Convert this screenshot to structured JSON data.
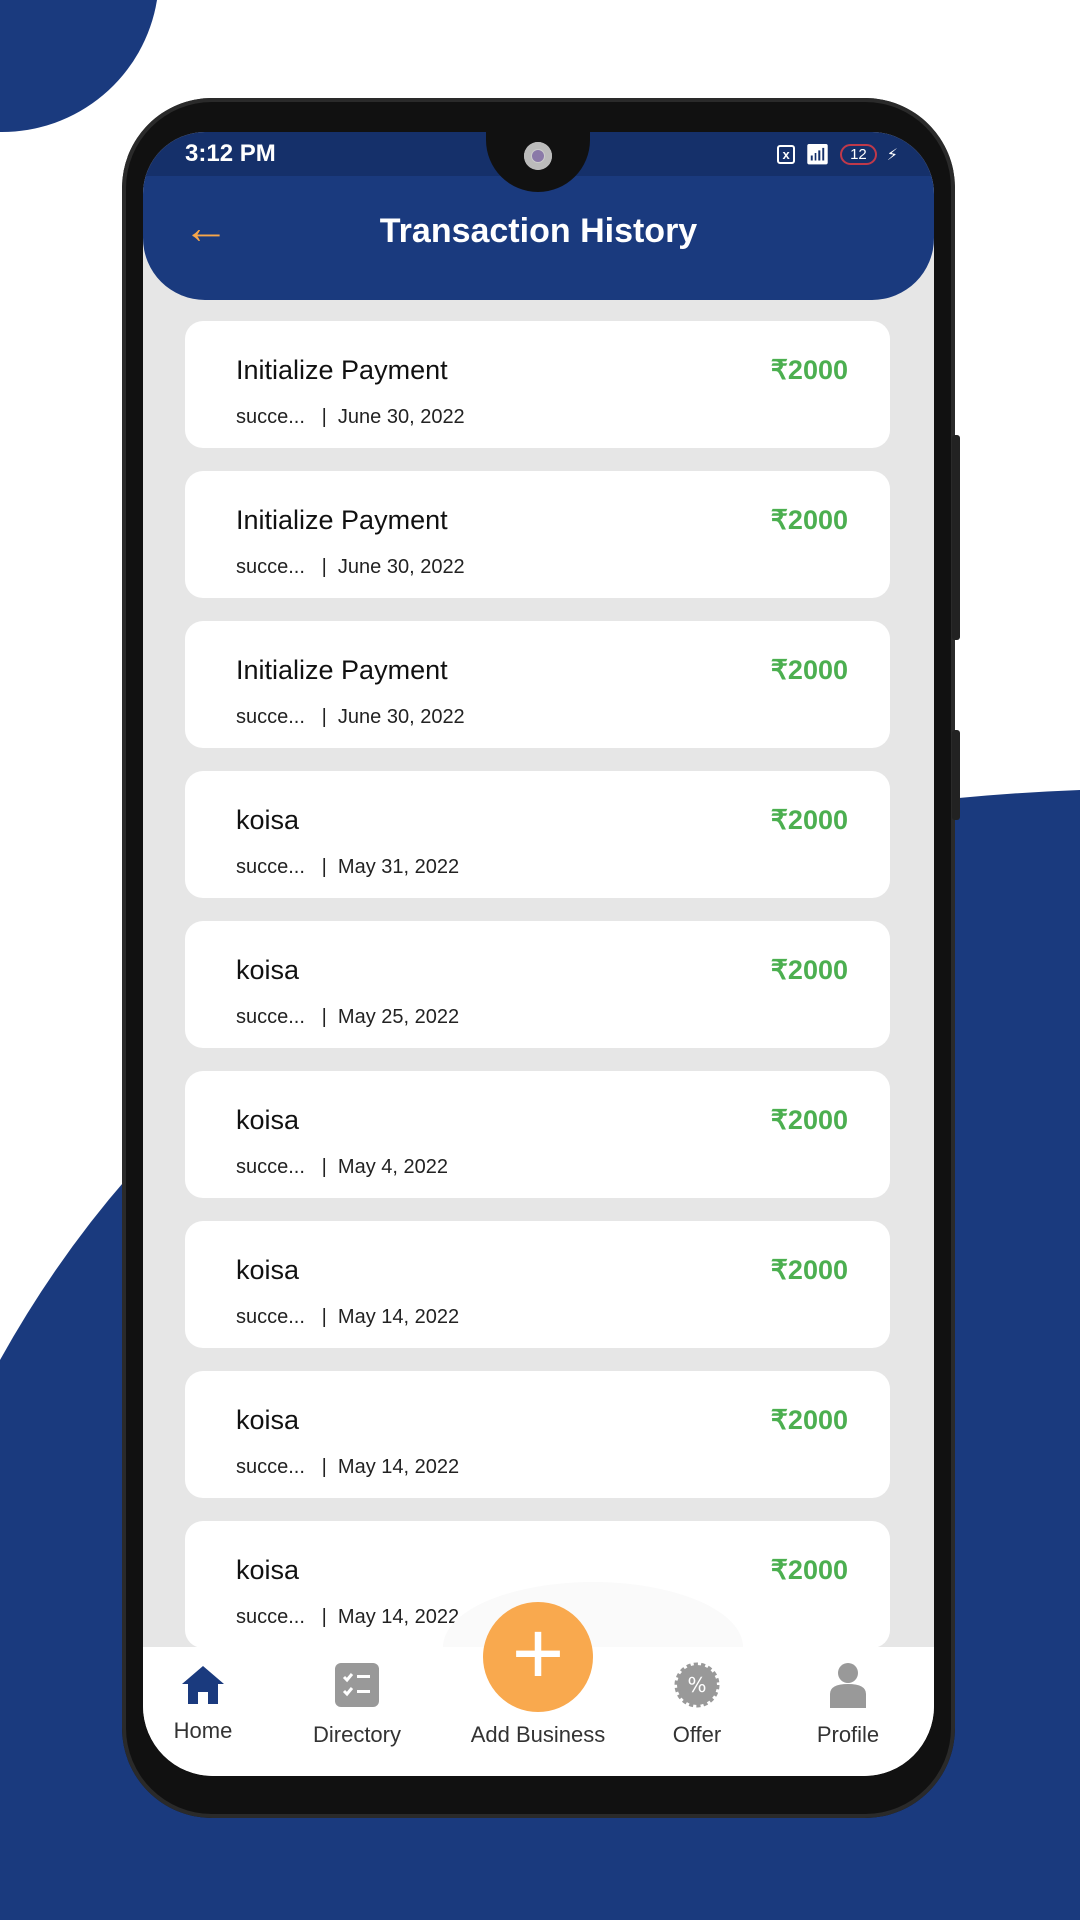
{
  "status_bar": {
    "time": "3:12 PM",
    "battery": "12"
  },
  "header": {
    "title": "Transaction History"
  },
  "colors": {
    "brand": "#1a3a7e",
    "accent": "#f9a94e",
    "amount": "#4caf50"
  },
  "transactions": [
    {
      "name": "Initialize Payment",
      "amount": "₹2000",
      "status": "succe...",
      "date": "June 30, 2022"
    },
    {
      "name": "Initialize Payment",
      "amount": "₹2000",
      "status": "succe...",
      "date": "June 30, 2022"
    },
    {
      "name": "Initialize Payment",
      "amount": "₹2000",
      "status": "succe...",
      "date": "June 30, 2022"
    },
    {
      "name": "koisa",
      "amount": "₹2000",
      "status": "succe...",
      "date": "May 31, 2022"
    },
    {
      "name": "koisa",
      "amount": "₹2000",
      "status": "succe...",
      "date": "May 25, 2022"
    },
    {
      "name": "koisa",
      "amount": "₹2000",
      "status": "succe...",
      "date": "May 4, 2022"
    },
    {
      "name": "koisa",
      "amount": "₹2000",
      "status": "succe...",
      "date": "May 14, 2022"
    },
    {
      "name": "koisa",
      "amount": "₹2000",
      "status": "succe...",
      "date": "May 14, 2022"
    },
    {
      "name": "koisa",
      "amount": "₹2000",
      "status": "succe...",
      "date": "May 14, 2022"
    }
  ],
  "nav": {
    "home": "Home",
    "directory": "Directory",
    "add_business": "Add Business",
    "offer": "Offer",
    "profile": "Profile"
  }
}
